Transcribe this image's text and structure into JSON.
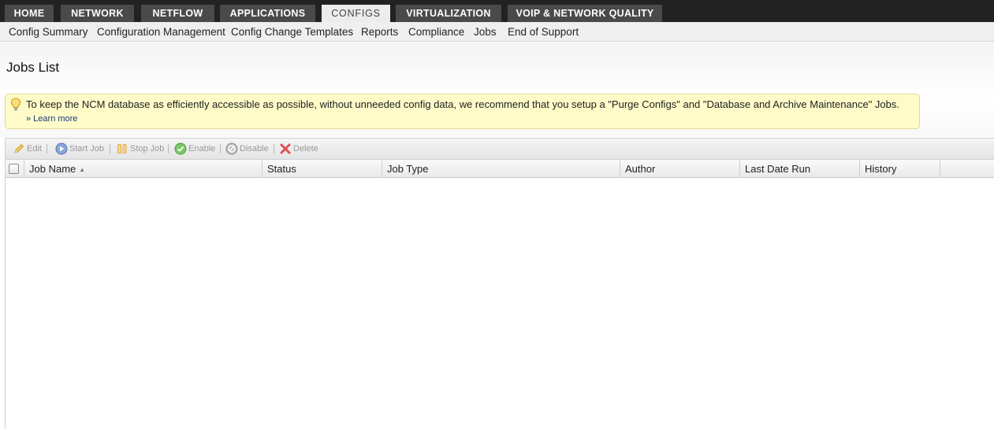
{
  "top_tabs": [
    {
      "label": "HOME",
      "active": false
    },
    {
      "label": "NETWORK",
      "active": false
    },
    {
      "label": "NETFLOW",
      "active": false
    },
    {
      "label": "APPLICATIONS",
      "active": false
    },
    {
      "label": "CONFIGS",
      "active": true
    },
    {
      "label": "VIRTUALIZATION",
      "active": false
    },
    {
      "label": "VOIP & NETWORK QUALITY",
      "active": false
    }
  ],
  "sub_nav": [
    "Config Summary",
    "Configuration Management",
    "Config Change Templates",
    "Reports",
    "Compliance",
    "Jobs",
    "End of Support"
  ],
  "page": {
    "title": "Jobs List"
  },
  "notice": {
    "icon": "lightbulb-icon",
    "message": "To keep the NCM database as efficiently accessible as possible, without unneeded config data, we recommend that you setup a \"Purge Configs\" and \"Database and Archive Maintenance\" Jobs.",
    "link": "» Learn more"
  },
  "toolbar": {
    "edit": "Edit",
    "start_job": "Start Job",
    "stop_job": "Stop Job",
    "enable": "Enable",
    "disable": "Disable",
    "delete": "Delete"
  },
  "grid": {
    "columns": [
      "Job Name",
      "Status",
      "Job Type",
      "Author",
      "Last Date Run",
      "History"
    ],
    "sort_indicator": "▲",
    "rows": []
  },
  "colors": {
    "topbar": "#222222",
    "tab": "#4a4a4a",
    "tab_active": "#ececec",
    "notice_bg": "#fefbc8",
    "link": "#1a3d7c"
  }
}
